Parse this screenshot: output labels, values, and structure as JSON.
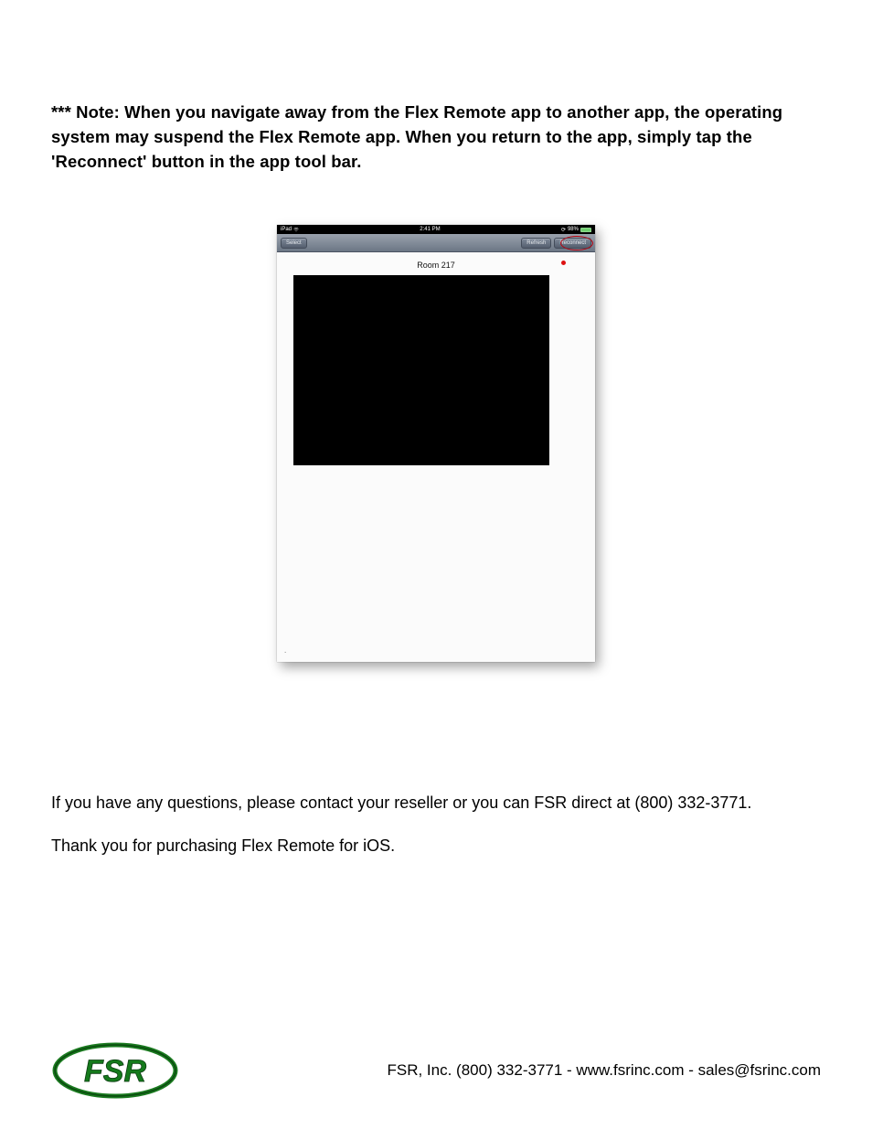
{
  "note_text": "*** Note: When you navigate away from the Flex Remote app to another app, the operating system may suspend the Flex Remote app. When you return to the app, simply tap the 'Reconnect' button in the app tool bar.",
  "screenshot": {
    "status": {
      "device": "iPad",
      "time": "2:41 PM",
      "battery_pct": "98%"
    },
    "toolbar": {
      "select_label": "Select",
      "refresh_label": "Refresh",
      "reconnect_label": "Reconnect"
    },
    "room_label": "Room 217"
  },
  "contact_text": "If you have any questions, please contact your reseller or you can FSR direct at (800) 332-3771.",
  "thanks_text": "Thank you for purchasing Flex Remote for iOS.",
  "footer_text": "FSR, Inc. (800) 332-3771 - www.fsrinc.com - sales@fsrinc.com",
  "logo_alt": "FSR"
}
